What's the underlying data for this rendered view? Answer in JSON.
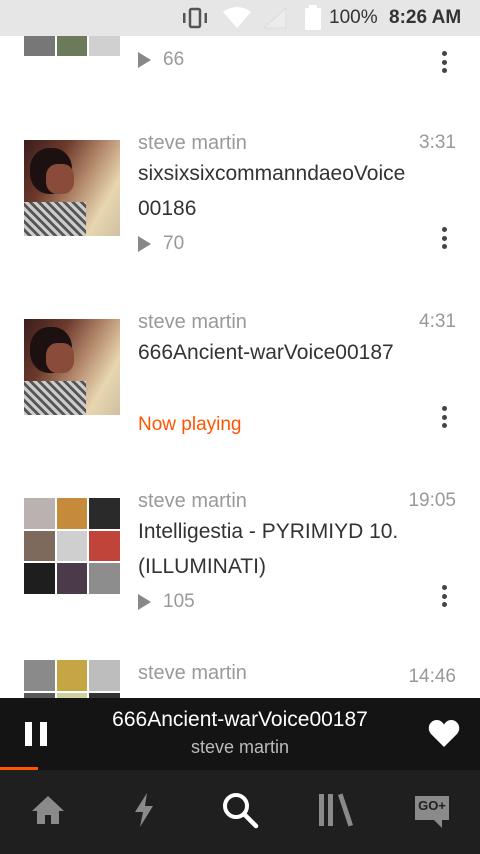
{
  "status_bar": {
    "battery": "100%",
    "time": "8:26 AM",
    "icons": [
      "vibrate-icon",
      "wifi-icon",
      "signal-icon",
      "battery-icon"
    ]
  },
  "tracks": [
    {
      "artist": "",
      "duration": "",
      "title": "",
      "plays": "66",
      "artwork": "collage"
    },
    {
      "artist": "steve martin",
      "duration": "3:31",
      "title": "sixsixsixcommanndaeoVoice00186",
      "plays": "70",
      "artwork": "portrait"
    },
    {
      "artist": "steve martin",
      "duration": "4:31",
      "title": "666Ancient-warVoice00187",
      "status": "Now playing",
      "artwork": "portrait"
    },
    {
      "artist": "steve martin",
      "duration": "19:05",
      "title": "Intelligestia - PYRIMIYD 10. (ILLUMINATI)",
      "plays": "105",
      "artwork": "collage"
    },
    {
      "artist": "steve martin",
      "duration": "14:46",
      "title": "",
      "plays": "",
      "artwork": "collage"
    }
  ],
  "mini_player": {
    "title": "666Ancient-warVoice00187",
    "artist": "steve martin",
    "progress": 0.08
  },
  "nav": {
    "items": [
      {
        "name": "home",
        "icon": "home-icon"
      },
      {
        "name": "stream",
        "icon": "lightning-icon"
      },
      {
        "name": "search",
        "icon": "search-icon"
      },
      {
        "name": "library",
        "icon": "library-icon"
      },
      {
        "name": "go-plus",
        "icon": "go-plus-icon",
        "label": "GO+"
      }
    ]
  },
  "colors": {
    "accent": "#ff5500",
    "player_bg": "#141414",
    "nav_bg": "#1f1f1f",
    "status_bg": "#e6e6e6"
  }
}
